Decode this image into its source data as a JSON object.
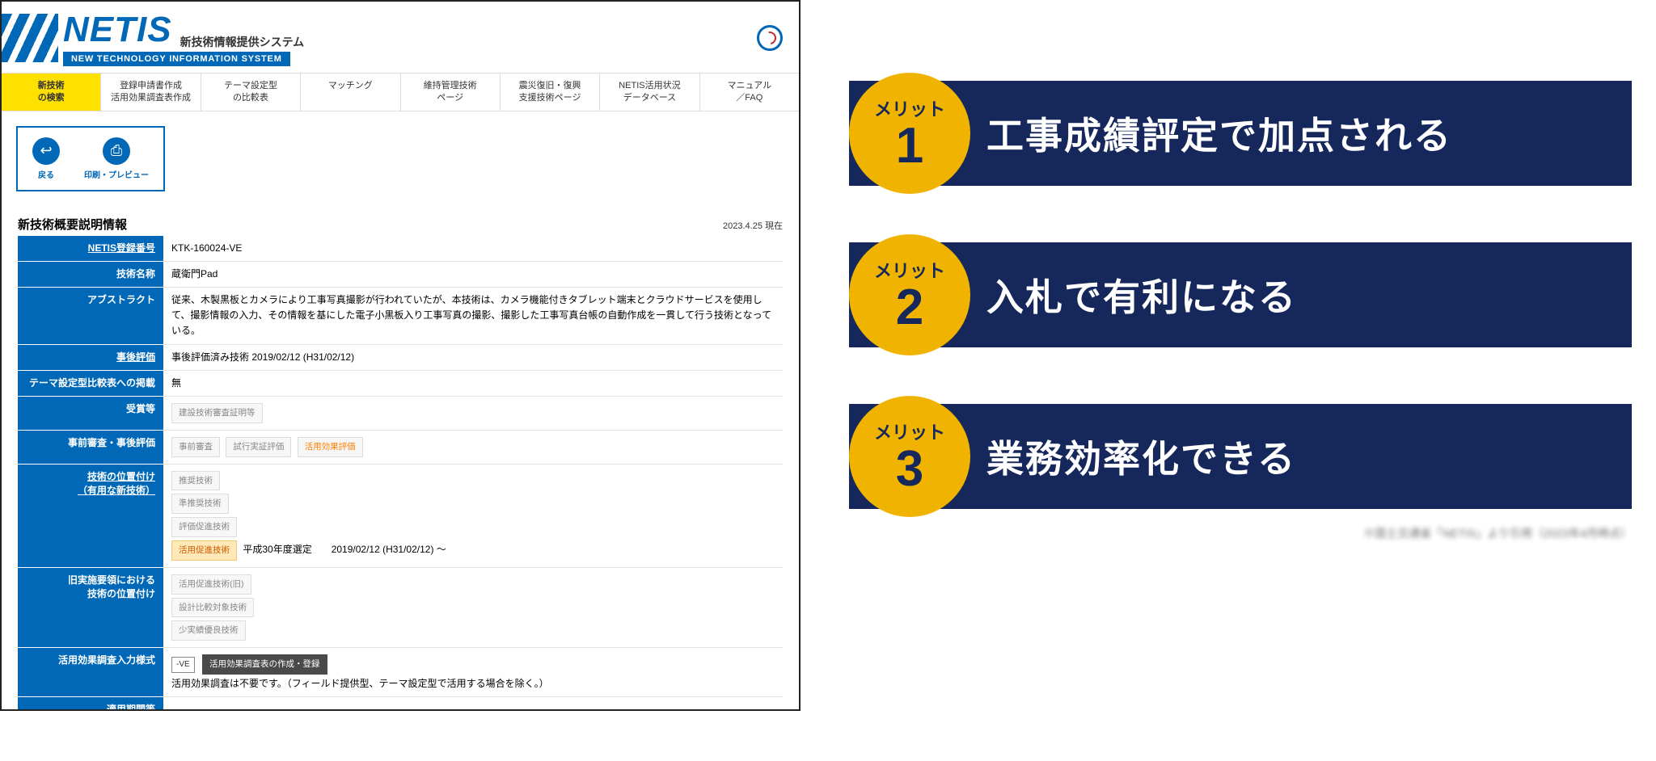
{
  "header": {
    "logo": "NETIS",
    "jp": "新技術情報提供システム",
    "sub": "NEW TECHNOLOGY INFORMATION SYSTEM"
  },
  "nav": [
    {
      "l1": "新技術",
      "l2": "の検索",
      "active": true
    },
    {
      "l1": "登録申請書作成",
      "l2": "活用効果調査表作成"
    },
    {
      "l1": "テーマ設定型",
      "l2": "の比較表"
    },
    {
      "l1": "マッチング",
      "l2": ""
    },
    {
      "l1": "維持管理技術",
      "l2": "ページ"
    },
    {
      "l1": "震災復旧・復興",
      "l2": "支援技術ページ"
    },
    {
      "l1": "NETIS活用状況",
      "l2": "データベース"
    },
    {
      "l1": "マニュアル",
      "l2": "／FAQ"
    }
  ],
  "toolbar": {
    "back": "戻る",
    "print": "印刷・プレビュー"
  },
  "section": {
    "title": "新技術概要説明情報",
    "date": "2023.4.25 現在"
  },
  "rows": {
    "regnum_label": "NETIS登録番号",
    "regnum": "KTK-160024-VE",
    "name_label": "技術名称",
    "name": "蔵衛門Pad",
    "abstract_label": "アブストラクト",
    "abstract": "従来、木製黒板とカメラにより工事写真撮影が行われていたが、本技術は、カメラ機能付きタブレット端末とクラウドサービスを使用して、撮影情報の入力、その情報を基にした電子小黒板入り工事写真の撮影、撮影した工事写真台帳の自動作成を一貫して行う技術となっている。",
    "post_eval_label": "事後評価",
    "post_eval": "事後評価済み技術 2019/02/12 (H31/02/12)",
    "theme_label": "テーマ設定型比較表への掲載",
    "theme": "無",
    "award_label": "受賞等",
    "award_pill": "建設技術審査証明等",
    "pre_eval_label": "事前審査・事後評価",
    "pre_eval_pills": [
      "事前審査",
      "試行実証評価"
    ],
    "pre_eval_pill_accent": "活用効果評価",
    "position_label_1": "技術の位置付け",
    "position_label_2": "（有用な新技術）",
    "position_pills": [
      "推奨技術",
      "準推奨技術",
      "評価促進技術"
    ],
    "position_on": "活用促進技術",
    "position_text": "平成30年度選定　　2019/02/12 (H31/02/12) ～",
    "old_label_1": "旧実施要領における",
    "old_label_2": "技術の位置付け",
    "old_pills": [
      "活用促進技術(旧)",
      "設計比較対象技術",
      "少実績優良技術"
    ],
    "survey_label": "活用効果調査入力様式",
    "survey_badge": "-VE",
    "survey_btn": "活用効果調査表の作成・登録",
    "survey_note": "活用効果調査は不要です。（フィールド提供型、テーマ設定型で活用する場合を除く。）",
    "period_label": "適用期間等"
  },
  "merits": [
    {
      "num": "1",
      "title": "工事成績評定で加点される"
    },
    {
      "num": "2",
      "title": "入札で有利になる"
    },
    {
      "num": "3",
      "title": "業務効率化できる"
    }
  ],
  "merit_label": "メリット",
  "footnote": "※国土交通省「NETIS」より引用（2023年4月時点）"
}
